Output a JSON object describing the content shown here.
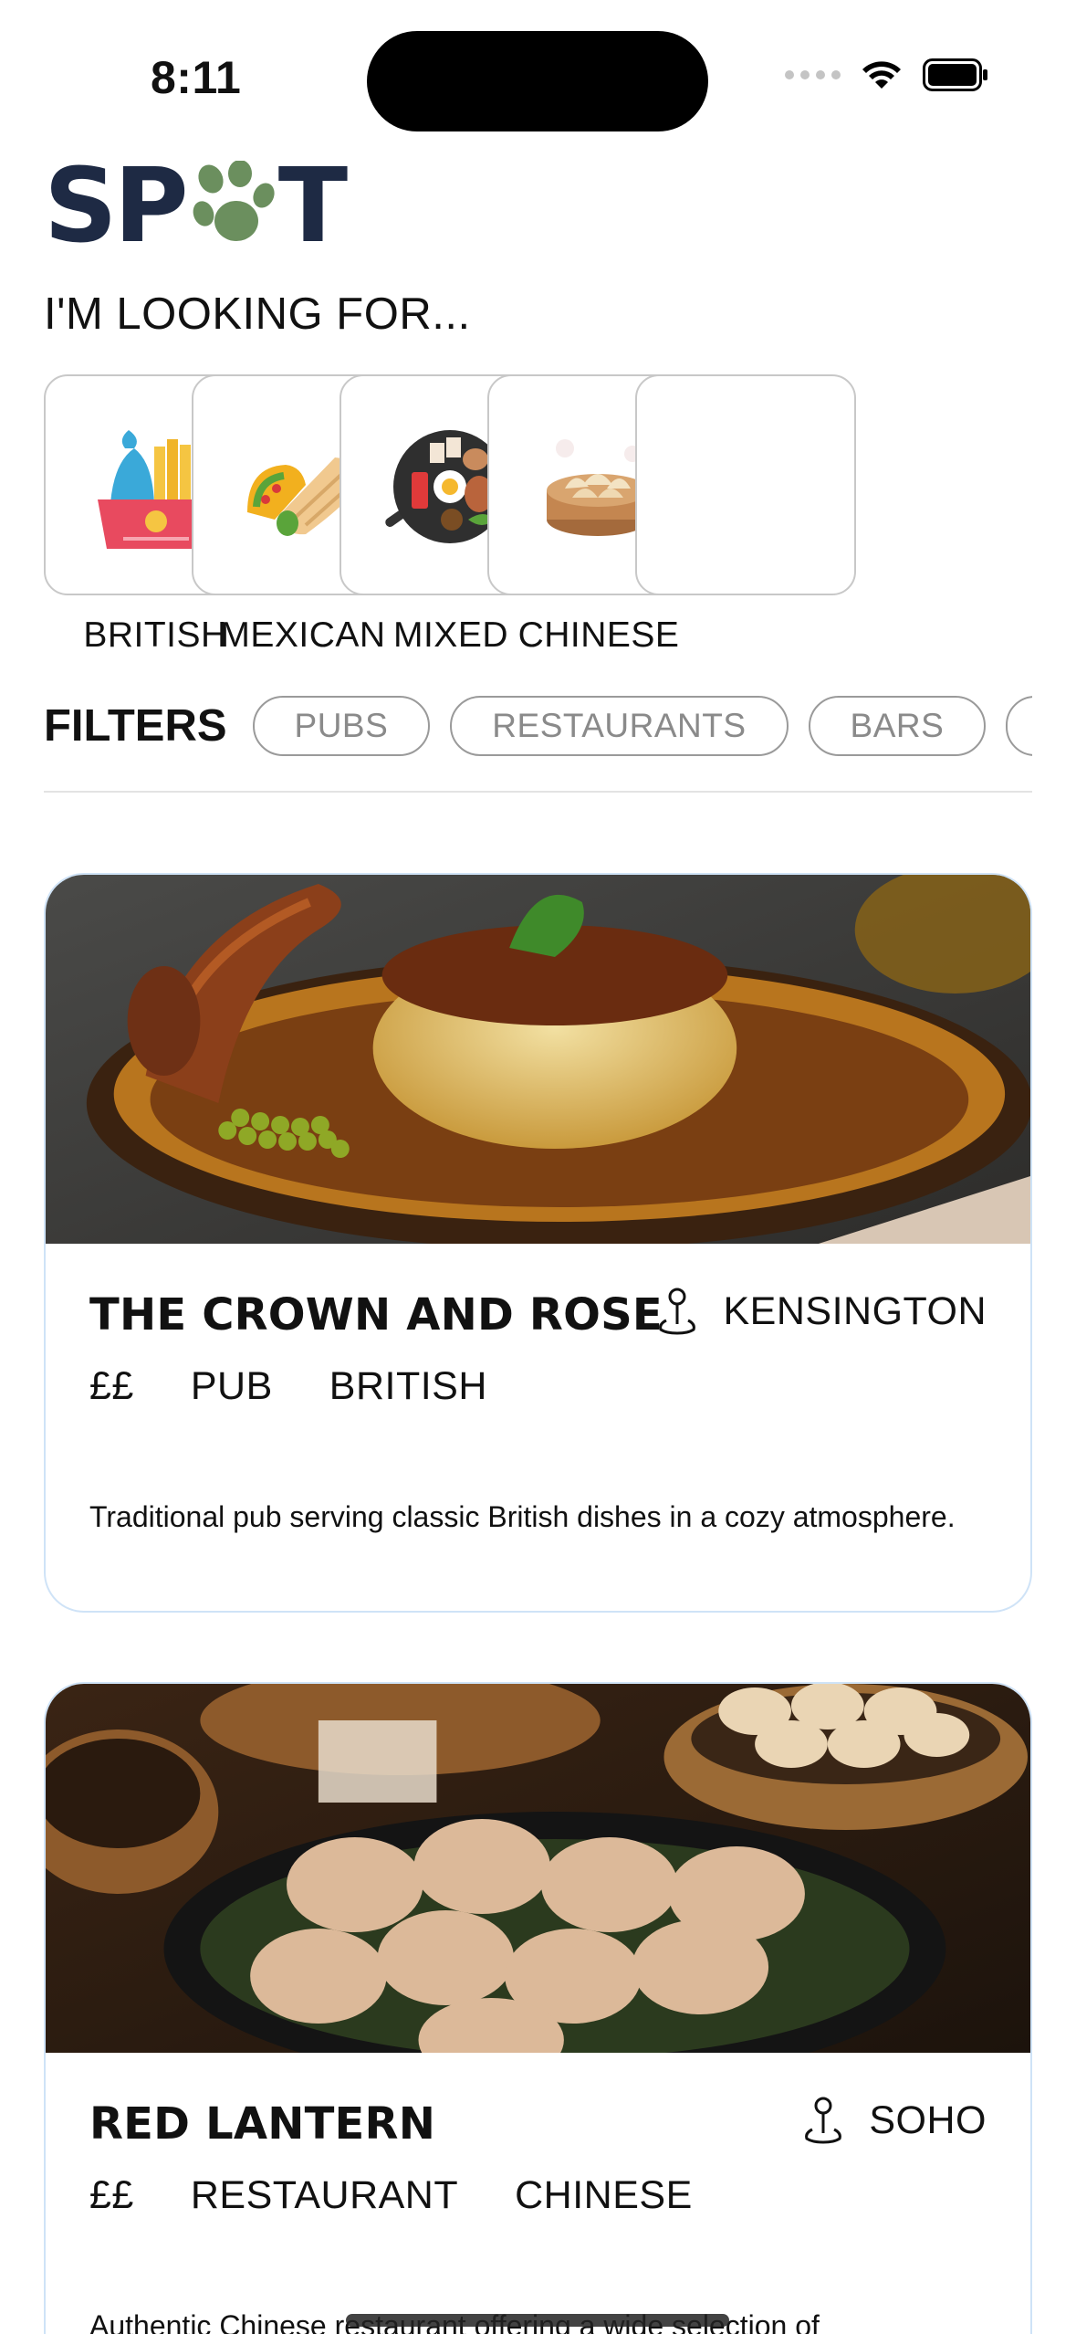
{
  "status": {
    "time": "8:11"
  },
  "logo": {
    "text_before": "SP",
    "text_after": "T"
  },
  "heading": "I'M LOOKING FOR...",
  "categories": [
    {
      "label": "BRITISH",
      "icon": "fish-and-chips-icon"
    },
    {
      "label": "MEXICAN",
      "icon": "taco-burrito-icon"
    },
    {
      "label": "MIXED",
      "icon": "breakfast-pan-icon"
    },
    {
      "label": "CHINESE",
      "icon": "dumpling-basket-icon"
    }
  ],
  "filters": {
    "title": "FILTERS",
    "chips": [
      "PUBS",
      "RESTAURANTS",
      "BARS"
    ]
  },
  "venues": [
    {
      "name": "THE CROWN AND ROSE",
      "location": "KENSINGTON",
      "price": "££",
      "type": "PUB",
      "cuisine": "BRITISH",
      "description": "Traditional pub serving classic British dishes in a cozy atmosphere."
    },
    {
      "name": "RED LANTERN",
      "location": "SOHO",
      "price": "££",
      "type": "RESTAURANT",
      "cuisine": "CHINESE",
      "description": "Authentic Chinese restaurant offering a wide selection of"
    }
  ],
  "colors": {
    "brand_navy": "#1e2a44",
    "brand_green": "#6b8f5e",
    "card_border": "#cfe3f7"
  }
}
